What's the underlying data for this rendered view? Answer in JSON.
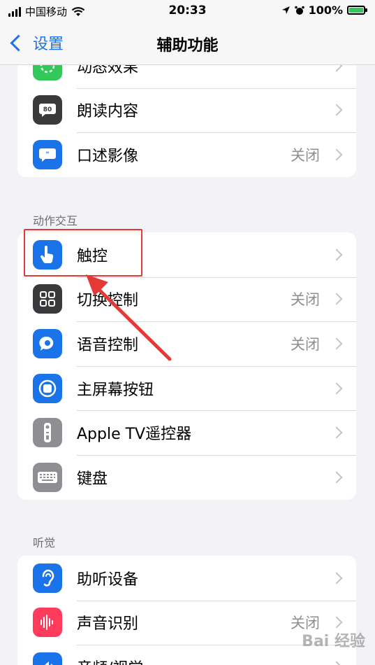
{
  "status_bar": {
    "carrier": "中国移动",
    "time": "20:33",
    "battery": "100%"
  },
  "nav": {
    "back_label": "设置",
    "title": "辅助功能"
  },
  "group_top": [
    {
      "label": "动态效果",
      "value": "",
      "icon": "motion-icon",
      "color": "#34c759"
    },
    {
      "label": "朗读内容",
      "value": "",
      "icon": "speech-bubble-icon",
      "color": "#3a3a3c"
    },
    {
      "label": "口述影像",
      "value": "关闭",
      "icon": "audio-description-icon",
      "color": "#1a73e8"
    }
  ],
  "section_interaction": "动作交互",
  "group_interaction": [
    {
      "label": "触控",
      "value": "",
      "icon": "touch-hand-icon",
      "color": "#1a73e8"
    },
    {
      "label": "切换控制",
      "value": "关闭",
      "icon": "switch-control-icon",
      "color": "#3a3a3c"
    },
    {
      "label": "语音控制",
      "value": "关闭",
      "icon": "voice-control-icon",
      "color": "#1a73e8"
    },
    {
      "label": "主屏幕按钮",
      "value": "",
      "icon": "home-button-icon",
      "color": "#1a73e8"
    },
    {
      "label": "Apple TV遥控器",
      "value": "",
      "icon": "remote-icon",
      "color": "#8e8e93"
    },
    {
      "label": "键盘",
      "value": "",
      "icon": "keyboard-icon",
      "color": "#8e8e93"
    }
  ],
  "section_hearing": "听觉",
  "group_hearing": [
    {
      "label": "助听设备",
      "value": "",
      "icon": "ear-icon",
      "color": "#1a73e8"
    },
    {
      "label": "声音识别",
      "value": "关闭",
      "icon": "sound-recognition-icon",
      "color": "#ff3b5c"
    },
    {
      "label": "音频/视觉",
      "value": "",
      "icon": "speaker-icon",
      "color": "#1a73e8"
    }
  ],
  "watermark": "Bai 经验"
}
